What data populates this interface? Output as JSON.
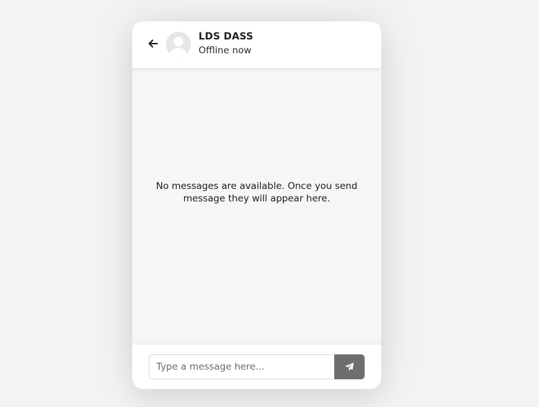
{
  "header": {
    "back_icon": "arrow-left-icon",
    "avatar_icon": "default-user-avatar",
    "user_name": "LDS DASS",
    "status": "Offline now"
  },
  "chat": {
    "empty_message": "No messages are available. Once you send message they will appear here."
  },
  "composer": {
    "input_value": "",
    "placeholder": "Type a message here...",
    "send_icon": "paper-plane-icon"
  },
  "colors": {
    "page_background": "#f3f3f3",
    "card_background": "#ffffff",
    "chat_background": "#f6f6f6",
    "send_button": "#6e6e6e",
    "text_primary": "#1f1f1f"
  }
}
